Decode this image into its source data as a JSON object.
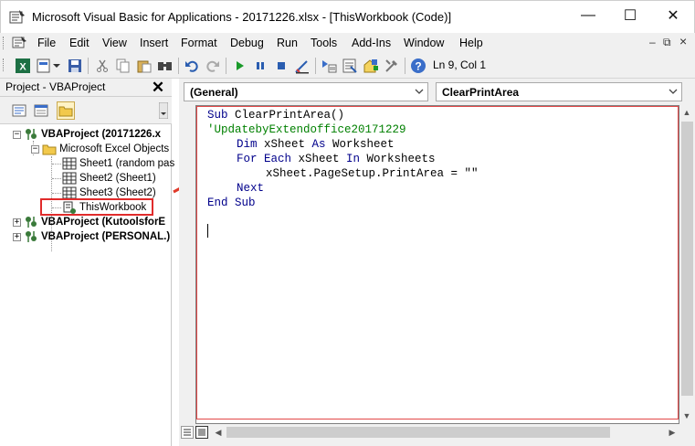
{
  "window": {
    "title": "Microsoft Visual Basic for Applications - 20171226.xlsx - [ThisWorkbook (Code)]",
    "minimize_glyph": "—",
    "maximize_glyph": "☐",
    "close_glyph": "✕"
  },
  "menu": {
    "items": [
      "File",
      "Edit",
      "View",
      "Insert",
      "Format",
      "Debug",
      "Run",
      "Tools",
      "Add-Ins",
      "Window",
      "Help"
    ],
    "mdi_minimize": "–",
    "mdi_restore": "⧉",
    "mdi_close": "×"
  },
  "toolbar": {
    "cursor_position": "Ln 9, Col 1",
    "icons": [
      "excel-icon",
      "insert-module-icon",
      "save-icon",
      "cut-icon",
      "copy-icon",
      "paste-icon",
      "find-icon",
      "undo-icon",
      "redo-icon",
      "run-icon",
      "break-icon",
      "reset-icon",
      "design-mode-icon",
      "project-explorer-icon",
      "properties-icon",
      "object-browser-icon",
      "toolbox-icon",
      "help-icon"
    ]
  },
  "project_panel": {
    "title": "Project - VBAProject",
    "close_glyph": "✕",
    "tree": [
      {
        "label": "VBAProject (20171226.x",
        "bold": true,
        "expander": "−"
      },
      {
        "label": "Microsoft Excel Objects",
        "bold": false,
        "expander": "−"
      },
      {
        "label": "Sheet1 (random pas",
        "bold": false
      },
      {
        "label": "Sheet2 (Sheet1)",
        "bold": false
      },
      {
        "label": "Sheet3 (Sheet2)",
        "bold": false
      },
      {
        "label": "ThisWorkbook",
        "bold": false
      },
      {
        "label": "VBAProject (KutoolsforE",
        "bold": true,
        "expander": "+"
      },
      {
        "label": "VBAProject (PERSONAL.)",
        "bold": true,
        "expander": "+"
      }
    ]
  },
  "code_window": {
    "object_combo": "(General)",
    "procedure_combo": "ClearPrintArea",
    "lines": [
      {
        "indent": 0,
        "parts": [
          {
            "t": "Sub ",
            "k": "kw"
          },
          {
            "t": "ClearPrintArea()",
            "k": ""
          }
        ]
      },
      {
        "indent": 0,
        "parts": [
          {
            "t": "'UpdatebyExtendoffice20171229",
            "k": "cm"
          }
        ]
      },
      {
        "indent": 1,
        "parts": [
          {
            "t": "Dim ",
            "k": "kw"
          },
          {
            "t": "xSheet ",
            "k": ""
          },
          {
            "t": "As ",
            "k": "kw"
          },
          {
            "t": "Worksheet",
            "k": ""
          }
        ]
      },
      {
        "indent": 1,
        "parts": [
          {
            "t": "For Each ",
            "k": "kw"
          },
          {
            "t": "xSheet ",
            "k": ""
          },
          {
            "t": "In ",
            "k": "kw"
          },
          {
            "t": "Worksheets",
            "k": ""
          }
        ]
      },
      {
        "indent": 2,
        "parts": [
          {
            "t": "xSheet.PageSetup.PrintArea = \"\"",
            "k": ""
          }
        ]
      },
      {
        "indent": 1,
        "parts": [
          {
            "t": "Next",
            "k": "kw"
          }
        ]
      },
      {
        "indent": 0,
        "parts": [
          {
            "t": "End Sub",
            "k": "kw"
          }
        ]
      }
    ]
  },
  "colors": {
    "keyword": "#00008b",
    "comment": "#008000",
    "highlight_red": "#e02b2b",
    "selection_bg": "#fff3c6"
  }
}
